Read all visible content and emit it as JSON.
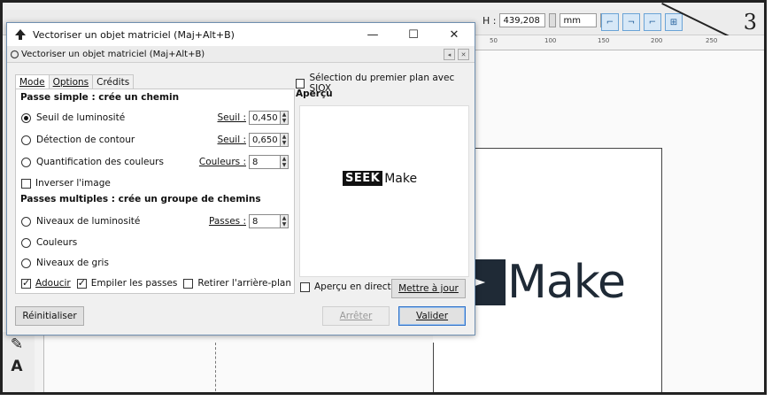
{
  "canvas": {
    "toolbar": {
      "h_label": "H :",
      "h_value": "439,208",
      "unit": "mm"
    },
    "ruler_ticks": [
      "50",
      "100",
      "150",
      "200",
      "250"
    ],
    "corner_number": "3",
    "big_logo_text": "Make"
  },
  "dialog": {
    "window_title": "Vectoriser un objet matriciel (Maj+Alt+B)",
    "subtitle": "Vectoriser un objet matriciel (Maj+Alt+B)",
    "tabs": [
      {
        "label": "Mode"
      },
      {
        "label": "Options"
      },
      {
        "label": "Crédits"
      }
    ],
    "single_pass": {
      "heading": "Passe simple : crée un chemin",
      "brightness": {
        "label": "Seuil de luminosité",
        "param_label": "Seuil :",
        "value": "0,450",
        "selected": true
      },
      "edge": {
        "label": "Détection de contour",
        "param_label": "Seuil :",
        "value": "0,650"
      },
      "colors": {
        "label": "Quantification des couleurs",
        "param_label": "Couleurs :",
        "value": "8"
      },
      "invert": {
        "label": "Inverser l'image",
        "checked": false
      }
    },
    "multi_pass": {
      "heading": "Passes multiples : crée un groupe de chemins",
      "brightness_levels": {
        "label": "Niveaux de luminosité",
        "param_label": "Passes :",
        "value": "8"
      },
      "colors": {
        "label": "Couleurs"
      },
      "grays": {
        "label": "Niveaux de gris"
      },
      "smooth": {
        "label": "Adoucir",
        "checked": true
      },
      "stack": {
        "label": "Empiler les passes",
        "checked": true
      },
      "remove_bg": {
        "label": "Retirer l'arrière-plan",
        "checked": false
      }
    },
    "siox": {
      "label": "Sélection du premier plan avec SIOX",
      "checked": false
    },
    "preview": {
      "heading": "Aperçu",
      "logo_black": "SEEK",
      "logo_text": "Make",
      "live_label": "Aperçu en direct",
      "live_checked": false,
      "update_button": "Mettre à jour"
    },
    "buttons": {
      "reset": "Réinitialiser",
      "stop": "Arrêter",
      "ok": "Valider"
    },
    "window_controls": {
      "minimize": "—",
      "maximize": "☐",
      "close": "✕"
    }
  }
}
